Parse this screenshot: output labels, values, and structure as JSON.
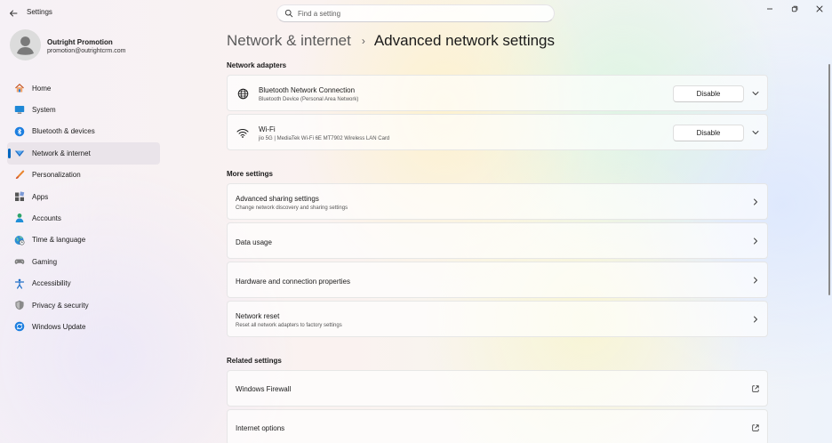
{
  "window": {
    "app_title": "Settings",
    "search_placeholder": "Find a setting"
  },
  "profile": {
    "name": "Outright Promotion",
    "email": "promotion@outrightcrm.com"
  },
  "sidebar": {
    "items": [
      {
        "label": "Home",
        "icon": "home-icon"
      },
      {
        "label": "System",
        "icon": "system-icon"
      },
      {
        "label": "Bluetooth & devices",
        "icon": "bluetooth-icon"
      },
      {
        "label": "Network & internet",
        "icon": "network-icon",
        "selected": true
      },
      {
        "label": "Personalization",
        "icon": "brush-icon"
      },
      {
        "label": "Apps",
        "icon": "apps-icon"
      },
      {
        "label": "Accounts",
        "icon": "accounts-icon"
      },
      {
        "label": "Time & language",
        "icon": "globe-clock-icon"
      },
      {
        "label": "Gaming",
        "icon": "gamepad-icon"
      },
      {
        "label": "Accessibility",
        "icon": "accessibility-icon"
      },
      {
        "label": "Privacy & security",
        "icon": "shield-icon"
      },
      {
        "label": "Windows Update",
        "icon": "update-icon"
      }
    ]
  },
  "breadcrumb": {
    "parent": "Network & internet",
    "separator": "›",
    "current": "Advanced network settings"
  },
  "sections": {
    "network_adapters": "Network adapters",
    "more_settings": "More settings",
    "related_settings": "Related settings"
  },
  "adapters": [
    {
      "title": "Bluetooth Network Connection",
      "subtitle": "Bluetooth Device (Personal Area Network)",
      "button": "Disable",
      "icon": "globe-icon"
    },
    {
      "title": "Wi-Fi",
      "subtitle": "jio 5G | MediaTek Wi-Fi 6E MT7902 Wireless LAN Card",
      "button": "Disable",
      "icon": "wifi-icon"
    }
  ],
  "more_settings": [
    {
      "title": "Advanced sharing settings",
      "subtitle": "Change network discovery and sharing settings"
    },
    {
      "title": "Data usage",
      "subtitle": ""
    },
    {
      "title": "Hardware and connection properties",
      "subtitle": ""
    },
    {
      "title": "Network reset",
      "subtitle": "Reset all network adapters to factory settings"
    }
  ],
  "related_settings": [
    {
      "title": "Windows Firewall"
    },
    {
      "title": "Internet options"
    }
  ],
  "colors": {
    "accent": "#0067c0"
  }
}
